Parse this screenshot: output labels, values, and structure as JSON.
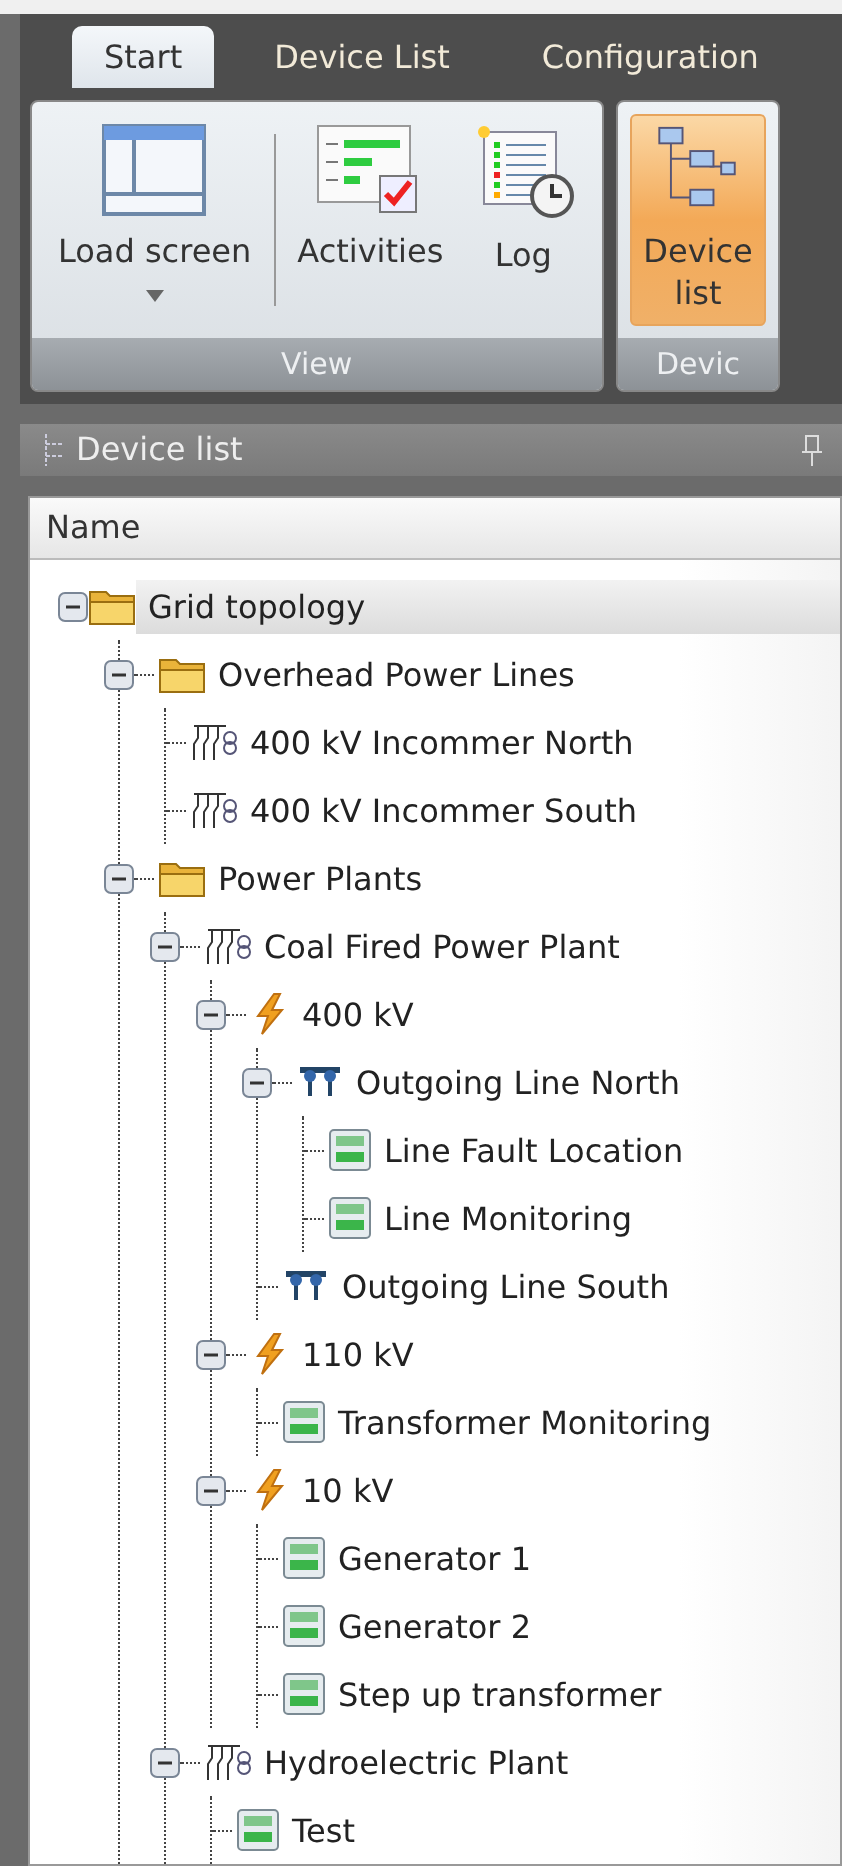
{
  "tabs": [
    {
      "label": "Start",
      "selected": true
    },
    {
      "label": "Device List",
      "selected": false
    },
    {
      "label": "Configuration",
      "selected": false
    }
  ],
  "ribbon": {
    "groups": [
      {
        "label": "View",
        "buttons": [
          {
            "kind": "layout",
            "label": "Load screen",
            "dropdown": true,
            "selected": false
          },
          {
            "kind": "activities",
            "label": "Activities",
            "dropdown": false,
            "selected": false
          },
          {
            "kind": "log",
            "label": "Log",
            "dropdown": false,
            "selected": false
          }
        ]
      },
      {
        "label": "Devic",
        "buttons": [
          {
            "kind": "tree",
            "label": "Device\nlist",
            "dropdown": false,
            "selected": true
          }
        ]
      }
    ]
  },
  "pane": {
    "title": "Device list"
  },
  "tree": {
    "column": "Name",
    "nodes": [
      {
        "kind": "folder",
        "label": "Grid topology",
        "selected": true,
        "expanded": true,
        "children": [
          {
            "kind": "folder",
            "label": "Overhead Power Lines",
            "selected": false,
            "expanded": true,
            "children": [
              {
                "kind": "feeder",
                "label": "400 kV Incommer North",
                "selected": false
              },
              {
                "kind": "feeder",
                "label": "400 kV Incommer South",
                "selected": false
              }
            ]
          },
          {
            "kind": "folder",
            "label": "Power Plants",
            "selected": false,
            "expanded": true,
            "children": [
              {
                "kind": "feeder",
                "label": "Coal Fired Power Plant",
                "selected": false,
                "expanded": true,
                "children": [
                  {
                    "kind": "voltage",
                    "label": "400 kV",
                    "selected": false,
                    "expanded": true,
                    "children": [
                      {
                        "kind": "bay",
                        "label": "Outgoing Line North",
                        "selected": false,
                        "expanded": true,
                        "children": [
                          {
                            "kind": "device",
                            "label": "Line Fault Location",
                            "selected": false
                          },
                          {
                            "kind": "device",
                            "label": "Line Monitoring",
                            "selected": false
                          }
                        ]
                      },
                      {
                        "kind": "bay",
                        "label": "Outgoing Line South",
                        "selected": false
                      }
                    ]
                  },
                  {
                    "kind": "voltage",
                    "label": "110 kV",
                    "selected": false,
                    "expanded": true,
                    "children": [
                      {
                        "kind": "device",
                        "label": "Transformer Monitoring",
                        "selected": false
                      }
                    ]
                  },
                  {
                    "kind": "voltage",
                    "label": "10 kV",
                    "selected": false,
                    "expanded": true,
                    "children": [
                      {
                        "kind": "device",
                        "label": "Generator 1",
                        "selected": false
                      },
                      {
                        "kind": "device",
                        "label": "Generator 2",
                        "selected": false
                      },
                      {
                        "kind": "device",
                        "label": "Step up transformer",
                        "selected": false
                      }
                    ]
                  }
                ]
              },
              {
                "kind": "feeder",
                "label": "Hydroelectric Plant",
                "selected": false,
                "expanded": true,
                "children": [
                  {
                    "kind": "device",
                    "label": "Test",
                    "selected": false
                  }
                ]
              }
            ]
          }
        ]
      }
    ]
  }
}
